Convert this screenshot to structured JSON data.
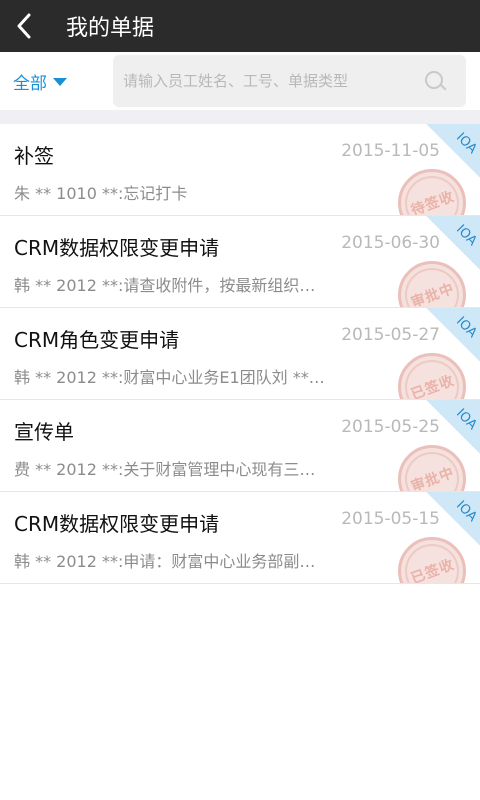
{
  "header": {
    "title": "我的单据"
  },
  "filter": {
    "label": "全部",
    "search_placeholder": "请输入员工姓名、工号、单据类型"
  },
  "items": [
    {
      "title": "补签",
      "date": "2015-11-05",
      "summary": "朱 ** 1010 **:忘记打卡",
      "corner": "IOA",
      "stamp": "待签收"
    },
    {
      "title": "CRM数据权限变更申请",
      "date": "2015-06-30",
      "summary": "韩 ** 2012 **:请查收附件，按最新组织…",
      "corner": "IOA",
      "stamp": "审批中"
    },
    {
      "title": "CRM角色变更申请",
      "date": "2015-05-27",
      "summary": "韩 ** 2012 **:财富中心业务E1团队刘 **…",
      "corner": "IOA",
      "stamp": "已签收"
    },
    {
      "title": "宣传单",
      "date": "2015-05-25",
      "summary": "费 ** 2012 **:关于财富管理中心现有三…",
      "corner": "IOA",
      "stamp": "审批中"
    },
    {
      "title": "CRM数据权限变更申请",
      "date": "2015-05-15",
      "summary": "韩 ** 2012 **:申请：财富中心业务部副…",
      "corner": "IOA",
      "stamp": "已签收"
    }
  ],
  "colors": {
    "header_bg": "#2b2b2b",
    "accent": "#1a8fd8",
    "corner_bg": "#cfe8f7",
    "stamp": "#e7a59a"
  }
}
